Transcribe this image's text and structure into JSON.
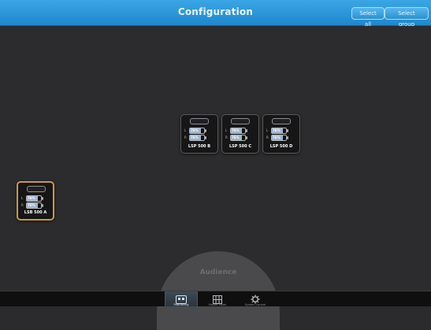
{
  "header": {
    "title": "Configuration",
    "select_all_label": "Select all",
    "select_group_label": "Select group"
  },
  "speakers": [
    {
      "name": "LSP 500 B",
      "left_ch": "L",
      "right_ch": "R",
      "left_level": "76%",
      "right_level": "76%",
      "left_value": 0.76,
      "right_value": 0.76,
      "selected": false
    },
    {
      "name": "LSP 500 C",
      "left_ch": "L",
      "right_ch": "R",
      "left_level": "76%",
      "right_level": "76%",
      "left_value": 0.76,
      "right_value": 0.76,
      "selected": false
    },
    {
      "name": "LSP 500 D",
      "left_ch": "L",
      "right_ch": "R",
      "left_level": "76%",
      "right_level": "76%",
      "left_value": 0.76,
      "right_value": 0.76,
      "selected": false
    },
    {
      "name": "LSB 500 A",
      "left_ch": "L",
      "right_ch": "R",
      "left_level": "76%",
      "right_level": "76%",
      "left_value": 0.76,
      "right_value": 0.76,
      "selected": true
    }
  ],
  "audience": {
    "label": "Audience"
  },
  "tabs": [
    {
      "label": "Positioning",
      "icon": "positioning-icon",
      "active": true
    },
    {
      "label": "Master Mode",
      "icon": "grid-icon",
      "active": false
    },
    {
      "label": "System Control",
      "icon": "gear-icon",
      "active": false
    }
  ],
  "colors": {
    "accent": "#2a93d6",
    "selected_border": "#c69a43",
    "workspace_bg": "#2c2c2e"
  }
}
